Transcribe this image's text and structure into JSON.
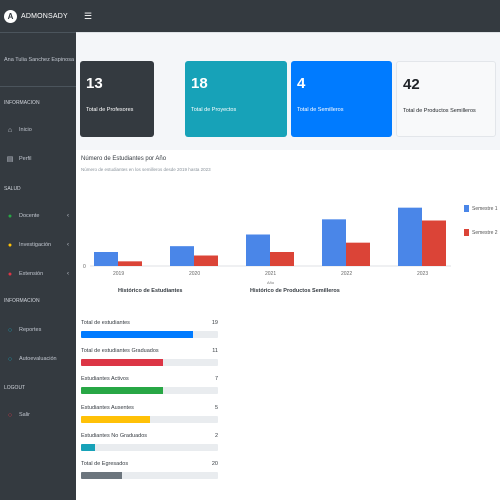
{
  "brand": {
    "logo_letter": "A",
    "name": "ADMONSADY"
  },
  "user": {
    "name": "Ana Tulia Sanchez Espinosa"
  },
  "sidebar": {
    "headers": [
      "INFORMACION",
      "SALUD",
      "INFORMACION",
      "LOGOUT"
    ],
    "items": [
      {
        "label": "Inicio",
        "icon": "home-icon"
      },
      {
        "label": "Perfil",
        "icon": "id-card-icon"
      },
      {
        "label": "Docente",
        "icon": "circle-icon",
        "color": "#28a745"
      },
      {
        "label": "Investigación",
        "icon": "circle-icon",
        "color": "#ffc107"
      },
      {
        "label": "Extensión",
        "icon": "circle-icon",
        "color": "#dc3545"
      },
      {
        "label": "Reportes",
        "icon": "circle-outline-icon",
        "color": "#17a2b8"
      },
      {
        "label": "Autoevaluación",
        "icon": "circle-outline-icon",
        "color": "#17a2b8"
      },
      {
        "label": "Salir",
        "icon": "circle-outline-icon",
        "color": "#dc3545"
      }
    ]
  },
  "boxes": [
    {
      "value": "13",
      "label": "Total de Profesores",
      "color": "#343a40"
    },
    {
      "value": "18",
      "label": "Total de Proyectos",
      "color": "#17a2b8"
    },
    {
      "value": "4",
      "label": "Total de Semilleros",
      "color": "#007bff"
    },
    {
      "value": "42",
      "label": "Total de Productos Semilleros",
      "color": "#f8f9fa"
    }
  ],
  "chart": {
    "title": "Número de Estudiantes por Año",
    "subtitle": "Número de estudiantes en los semilleros desde 2019 hasta 2023",
    "x_hint": "Año"
  },
  "chart_data": {
    "type": "bar",
    "categories": [
      "2019",
      "2020",
      "2021",
      "2022",
      "2023"
    ],
    "series": [
      {
        "name": "Semestre 1",
        "values": [
          12,
          17,
          27,
          40,
          50
        ],
        "color": "#4a86e8"
      },
      {
        "name": "Semestre 2",
        "values": [
          4,
          9,
          12,
          20,
          39
        ],
        "color": "#db4437"
      }
    ],
    "ylim": [
      0,
      60
    ]
  },
  "sections": {
    "left_title": "Histórico de Estudiantes",
    "right_title": "Histórico de Productos Semilleros"
  },
  "stats": [
    {
      "label": "Total de estudiantes",
      "value": "19",
      "fraction": 0.82,
      "color": "#007bff"
    },
    {
      "label": "Total de estudiantes Graduados",
      "value": "11",
      "fraction": 0.6,
      "color": "#dc3545"
    },
    {
      "label": "Estudiantes Activos",
      "value": "7",
      "fraction": 0.6,
      "color": "#28a745"
    },
    {
      "label": "Estudiantes Ausentes",
      "value": "5",
      "fraction": 0.5,
      "color": "#ffc107"
    },
    {
      "label": "Estudiantes No Graduados",
      "value": "2",
      "fraction": 0.1,
      "color": "#17a2b8"
    },
    {
      "label": "Total de Egresados",
      "value": "20",
      "fraction": 0.3,
      "color": "#6c757d"
    }
  ]
}
